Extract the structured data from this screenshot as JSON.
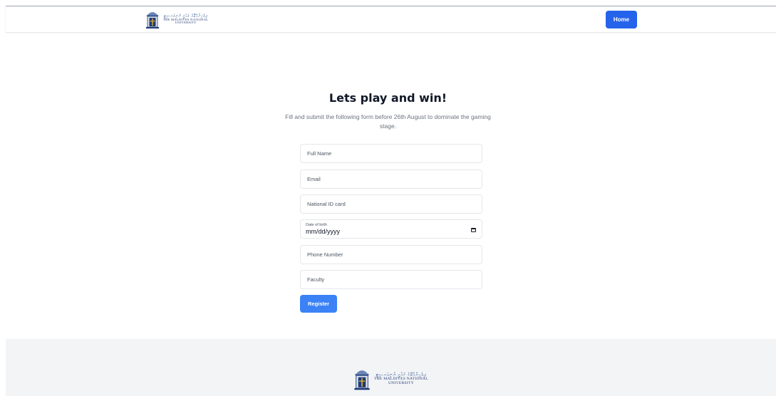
{
  "header": {
    "logo": {
      "script": "ދިވެހިރާއްޖޭގެ ޤައުމީ ޔުނިވަރސިޓީ",
      "name_line1": "THE MALDIVES NATIONAL",
      "name_line2": "UNIVERSITY"
    },
    "home_label": "Home"
  },
  "main": {
    "title": "Lets play and win!",
    "subtitle": "Fill and submit the following form before 26th August to dominate the gaming stage.",
    "form": {
      "full_name_placeholder": "Full Name",
      "email_placeholder": "Email",
      "national_id_placeholder": "National ID card",
      "dob_label": "Date of birth",
      "dob_value": "mm/dd/yyyy",
      "phone_placeholder": "Phone Number",
      "faculty_placeholder": "Faculty",
      "register_label": "Register"
    }
  },
  "footer": {
    "logo": {
      "script": "ދިވެހިރާއްޖޭގެ ޤައުމީ ޔުނިވަރސިޓީ",
      "name_line1": "THE MALDIVES NATIONAL",
      "name_line2": "UNIVERSITY"
    }
  },
  "colors": {
    "primary": "#2563eb",
    "register": "#3b82f6",
    "footer_bg": "#f3f4f6",
    "logo_blue": "#1f3b74"
  },
  "icons": {
    "logo": "university-emblem-icon",
    "date": "calendar-icon"
  }
}
